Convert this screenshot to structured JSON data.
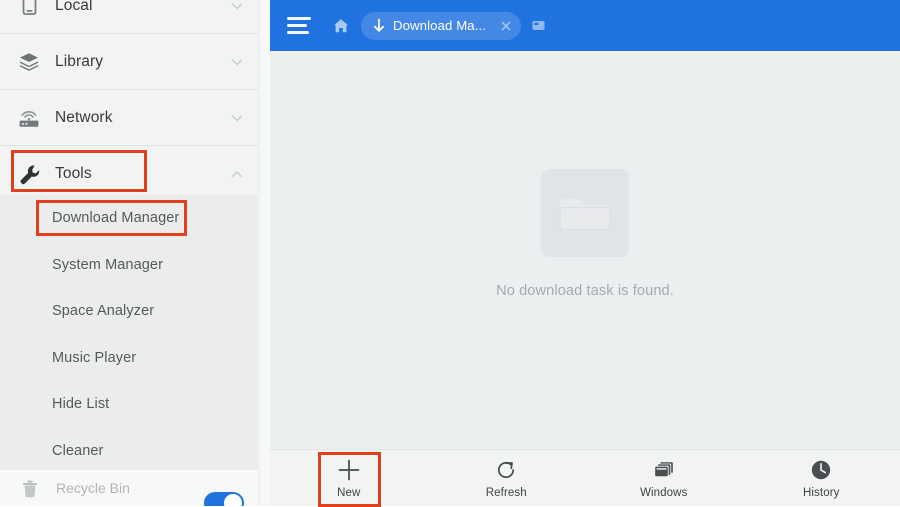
{
  "sidebar": {
    "sections": [
      {
        "label": "Local",
        "icon": "device-icon",
        "chevron": "chevron-down-icon",
        "expanded": false
      },
      {
        "label": "Library",
        "icon": "layers-icon",
        "chevron": "chevron-down-icon",
        "expanded": false
      },
      {
        "label": "Network",
        "icon": "router-icon",
        "chevron": "chevron-down-icon",
        "expanded": false
      },
      {
        "label": "Tools",
        "icon": "wrench-icon",
        "chevron": "chevron-up-icon",
        "expanded": true
      }
    ],
    "submenu": [
      {
        "label": "Download Manager",
        "selected": true
      },
      {
        "label": "System Manager",
        "selected": false
      },
      {
        "label": "Space Analyzer",
        "selected": false
      },
      {
        "label": "Music Player",
        "selected": false
      },
      {
        "label": "Hide List",
        "selected": false
      },
      {
        "label": "Cleaner",
        "selected": false
      }
    ],
    "bottom": {
      "label": "Recycle Bin",
      "icon": "trash-icon",
      "toggle_on": true,
      "toggle_color": "#1d74e0"
    }
  },
  "topbar": {
    "background": "#1f72e0",
    "menu_icon": "hamburger-menu-icon",
    "home_icon": "home-icon",
    "tab": {
      "icon": "download-arrow-icon",
      "title": "Download Ma...",
      "close_icon": "close-icon"
    },
    "new_tab_icon": "new-tab-icon"
  },
  "content": {
    "empty_icon": "folder-icon",
    "empty_message": "No download task is found."
  },
  "bottombar": {
    "items": [
      {
        "label": "New",
        "icon": "plus-icon",
        "highlighted": true
      },
      {
        "label": "Refresh",
        "icon": "refresh-icon",
        "highlighted": false
      },
      {
        "label": "Windows",
        "icon": "windows-stack-icon",
        "highlighted": false
      },
      {
        "label": "History",
        "icon": "clock-icon",
        "highlighted": false
      }
    ]
  },
  "annotations": {
    "color": "#e1401c",
    "boxes": [
      {
        "name": "tools-highlight"
      },
      {
        "name": "download-manager-highlight"
      },
      {
        "name": "new-button-highlight"
      }
    ]
  }
}
